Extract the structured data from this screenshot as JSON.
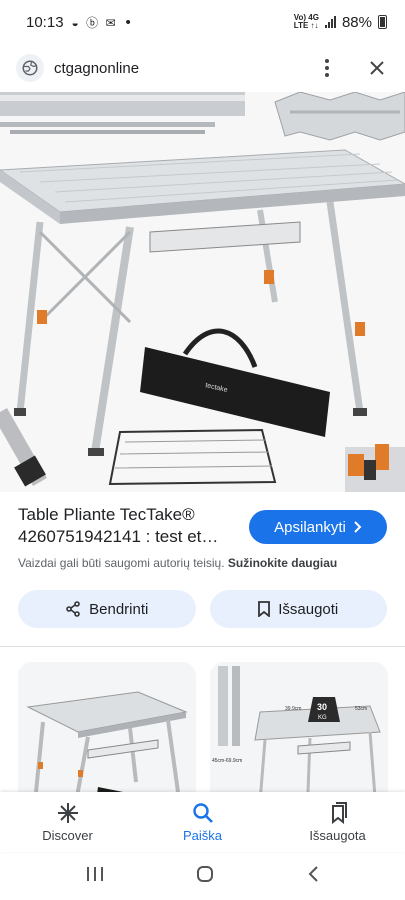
{
  "status": {
    "time": "10:13",
    "notif_icons": "◒ ⓑ ✉",
    "dot": "•",
    "net_top": "Vo) 4G",
    "net_bottom": "LTE ↑↓",
    "battery": "88%"
  },
  "browser": {
    "site": "ctgagnonline"
  },
  "result": {
    "title": "Table Pliante TecTake® 4260751942141 : test et…",
    "visit_label": "Apsilankyti",
    "note_prefix": "Vaizdai gali būti saugomi autorių teisių.",
    "note_link": "Sužinokite daugiau"
  },
  "actions": {
    "share_label": "Bendrinti",
    "save_label": "Išsaugoti"
  },
  "related": {
    "thumb2_dims": [
      "39.9cm",
      "53cm",
      "45cm-69.9cm"
    ],
    "thumb2_weight": "30",
    "thumb2_weight_unit": "KG"
  },
  "nav": {
    "items": [
      {
        "label": "Discover",
        "icon": "discover-icon"
      },
      {
        "label": "Paiška",
        "icon": "search-icon"
      },
      {
        "label": "Išsaugota",
        "icon": "saved-icon"
      }
    ],
    "active_color": "#1a73e8"
  },
  "colors": {
    "accent": "#1a73e8",
    "pill_bg": "#e8f0fe"
  }
}
